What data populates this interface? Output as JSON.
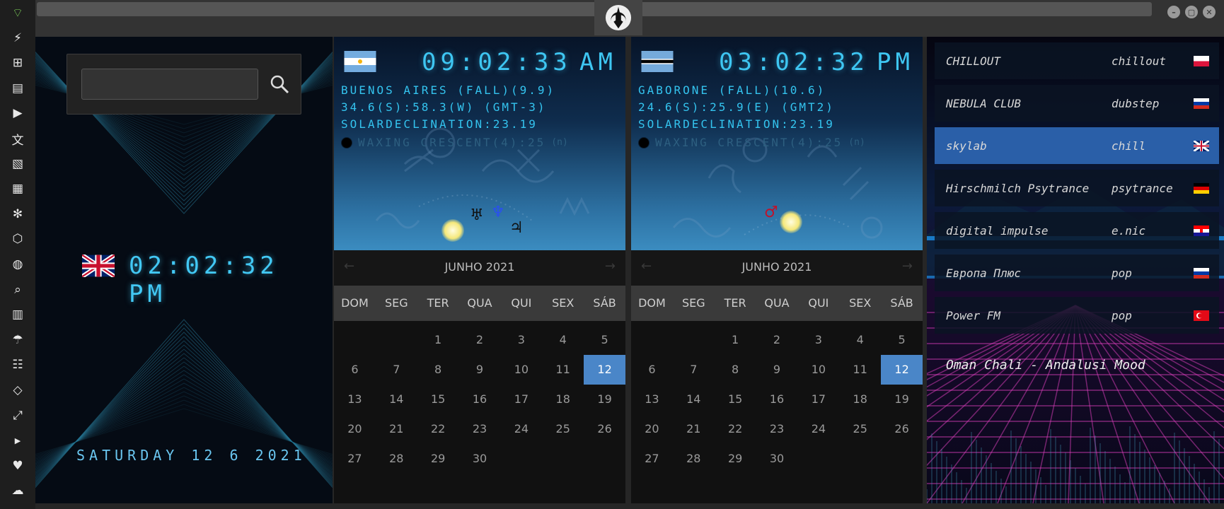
{
  "app": {
    "emblem_icon": "rebel-alliance-icon",
    "window_buttons": [
      "minimize",
      "maximize",
      "close"
    ]
  },
  "sidebar": {
    "icons": [
      "wifi-icon",
      "lightning-icon",
      "windows-icon",
      "archive-icon",
      "play-icon",
      "translate-icon",
      "image-icon",
      "news-icon",
      "aperture-icon",
      "hexagon-icon",
      "globe-icon",
      "search-icon",
      "map-icon",
      "umbrella-icon",
      "contacts-icon",
      "code-icon",
      "fullscreen-icon",
      "youtube-icon",
      "heart-icon",
      "cloud-icon"
    ]
  },
  "local_clock": {
    "search": {
      "value": "",
      "placeholder": ""
    },
    "flag": "uk",
    "time": "02:02:32 PM",
    "date": "SATURDAY 12 6 2021"
  },
  "cities": [
    {
      "flag": "argentina",
      "time": "09:02:33",
      "ampm": "AM",
      "line1": "BUENOS AIRES (FALL)(9.9)",
      "line2": "34.6(S):58.3(W) (GMT-3)",
      "line3": "SOLARDECLINATION:23.19",
      "moon": "WAXING CRESCENT(4):25",
      "moon_suffix": "(n)",
      "calendar": {
        "title": "JUNHO 2021",
        "weekdays": [
          "DOM",
          "SEG",
          "TER",
          "QUA",
          "QUI",
          "SEX",
          "SÁB"
        ],
        "weeks": [
          [
            "",
            "",
            "1",
            "2",
            "3",
            "4",
            "5"
          ],
          [
            "6",
            "7",
            "8",
            "9",
            "10",
            "11",
            "12"
          ],
          [
            "13",
            "14",
            "15",
            "16",
            "17",
            "18",
            "19"
          ],
          [
            "20",
            "21",
            "22",
            "23",
            "24",
            "25",
            "26"
          ],
          [
            "27",
            "28",
            "29",
            "30",
            "",
            "",
            ""
          ]
        ],
        "today": "12"
      }
    },
    {
      "flag": "botswana",
      "time": "03:02:32",
      "ampm": "PM",
      "line1": "GABORONE (FALL)(10.6)",
      "line2": "24.6(S):25.9(E) (GMT2)",
      "line3": "SOLARDECLINATION:23.19",
      "moon": "WAXING CRESCENT(4):25",
      "moon_suffix": "(n)",
      "calendar": {
        "title": "JUNHO 2021",
        "weekdays": [
          "DOM",
          "SEG",
          "TER",
          "QUA",
          "QUI",
          "SEX",
          "SÁB"
        ],
        "weeks": [
          [
            "",
            "",
            "1",
            "2",
            "3",
            "4",
            "5"
          ],
          [
            "6",
            "7",
            "8",
            "9",
            "10",
            "11",
            "12"
          ],
          [
            "13",
            "14",
            "15",
            "16",
            "17",
            "18",
            "19"
          ],
          [
            "20",
            "21",
            "22",
            "23",
            "24",
            "25",
            "26"
          ],
          [
            "27",
            "28",
            "29",
            "30",
            "",
            "",
            ""
          ]
        ],
        "today": "12"
      }
    }
  ],
  "radio": {
    "stations": [
      {
        "name": "CHILLOUT",
        "genre": "chillout",
        "flag": "poland",
        "active": false
      },
      {
        "name": "NEBULA CLUB",
        "genre": "dubstep",
        "flag": "russia",
        "active": false
      },
      {
        "name": "skylab",
        "genre": "chill",
        "flag": "uk",
        "active": true
      },
      {
        "name": "Hirschmilch Psytrance",
        "genre": "psytrance",
        "flag": "germany",
        "active": false
      },
      {
        "name": "digital impulse",
        "genre": "e.nic",
        "flag": "croatia",
        "active": false
      },
      {
        "name": "Европа Плюс",
        "genre": "pop",
        "flag": "russia",
        "active": false
      },
      {
        "name": "Power FM",
        "genre": "pop",
        "flag": "turkey",
        "active": false
      }
    ],
    "now_playing": "Oman Chali - Andalusi Mood"
  }
}
